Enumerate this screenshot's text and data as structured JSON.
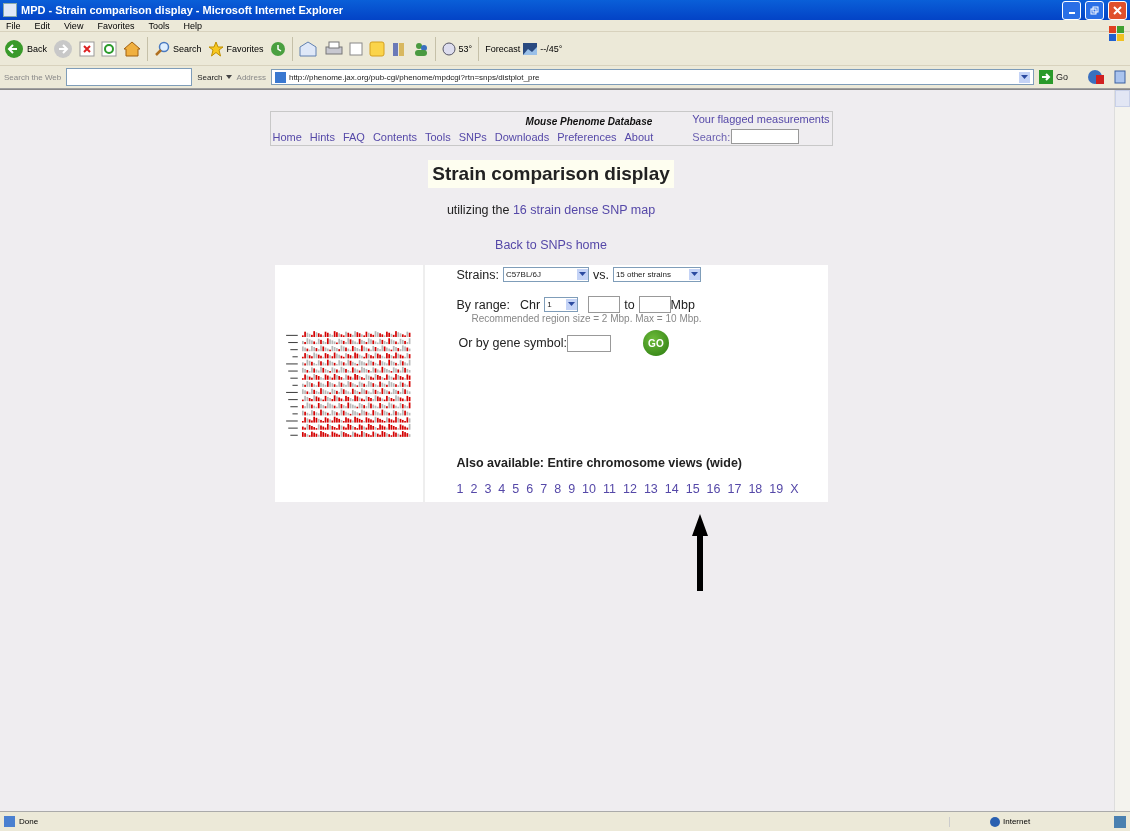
{
  "window": {
    "title": "MPD - Strain comparison display - Microsoft Internet Explorer"
  },
  "menu": [
    "File",
    "Edit",
    "View",
    "Favorites",
    "Tools",
    "Help"
  ],
  "toolbar": {
    "back": "Back",
    "search": "Search",
    "favorites": "Favorites",
    "weather": "53°",
    "forecast": "Forecast",
    "forecast_temp": "--/45°"
  },
  "search_bar": {
    "label": "Search the Web",
    "button": "Search"
  },
  "address_bar": {
    "label": "Address",
    "url": "http://phenome.jax.org/pub-cgi/phenome/mpdcgi?rtn=snps/distplot_pre",
    "go": "Go"
  },
  "header": {
    "title": "Mouse Phenome Database",
    "flagged_link": "Your flagged measurements",
    "nav": [
      "Home",
      "Hints",
      "FAQ",
      "Contents",
      "Tools",
      "SNPs",
      "Downloads",
      "Preferences",
      "About"
    ],
    "search_label": "Search:"
  },
  "page": {
    "title": "Strain comparison display",
    "subtitle": "utilizing the",
    "subtitle_link": "16 strain dense SNP map",
    "back_link": "Back to SNPs home"
  },
  "form": {
    "strains_label": "Strains:",
    "strain": "C57BL/6J",
    "vs_label": "vs.",
    "others": "15 other strains",
    "range_label": "By range:",
    "chr_label": "Chr",
    "chr": "1",
    "to_label": "to",
    "unit": "Mbp",
    "note": "Recommended region size = 2 Mbp. Max = 10 Mbp.",
    "gene_label": "Or by gene symbol:",
    "go": "GO",
    "also_available": "Also available: Entire chromosome views (wide)",
    "chromosomes": [
      "1",
      "2",
      "3",
      "4",
      "5",
      "6",
      "7",
      "8",
      "9",
      "10",
      "11",
      "12",
      "13",
      "14",
      "15",
      "16",
      "17",
      "18",
      "19",
      "X"
    ]
  },
  "status_bar": {
    "text": "Done",
    "zone": "Internet"
  }
}
